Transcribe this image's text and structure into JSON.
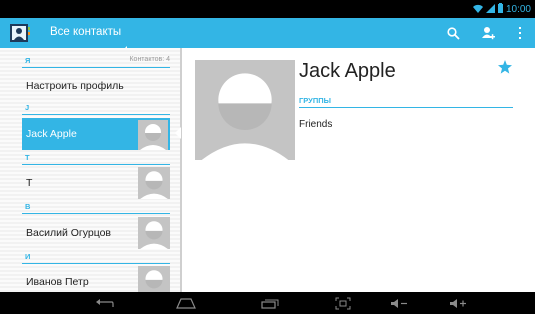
{
  "status_bar": {
    "time": "10:00",
    "icons": [
      "wifi-icon",
      "signal-icon",
      "battery-icon"
    ]
  },
  "action_bar": {
    "title": "Все контакты",
    "app_icon": "contacts-app-icon",
    "actions": [
      "search-icon",
      "add-contact-icon",
      "overflow-menu-icon"
    ],
    "color": "#33b5e5"
  },
  "contact_list": {
    "sections": [
      {
        "letter": "Я",
        "count_label": "Контактов: 4",
        "items": [
          {
            "name": "Настроить профиль",
            "has_photo": false
          }
        ]
      },
      {
        "letter": "J",
        "items": [
          {
            "name": "Jack Apple",
            "has_photo": true,
            "selected": true
          }
        ]
      },
      {
        "letter": "T",
        "items": [
          {
            "name": "T",
            "has_photo": true
          }
        ]
      },
      {
        "letter": "В",
        "items": [
          {
            "name": "Василий Огурцов",
            "has_photo": true
          }
        ]
      },
      {
        "letter": "И",
        "items": [
          {
            "name": "Иванов Петр",
            "has_photo": true
          }
        ]
      }
    ]
  },
  "detail": {
    "name": "Jack Apple",
    "starred": true,
    "groups_label": "ГРУППЫ",
    "groups_value": "Friends"
  },
  "nav_bar": {
    "buttons": [
      "back-icon",
      "home-icon",
      "recent-apps-icon",
      "screenshot-icon",
      "volume-down-icon",
      "volume-up-icon"
    ]
  },
  "colors": {
    "accent": "#33b5e5",
    "placeholder_photo": "#c4c4c4"
  }
}
